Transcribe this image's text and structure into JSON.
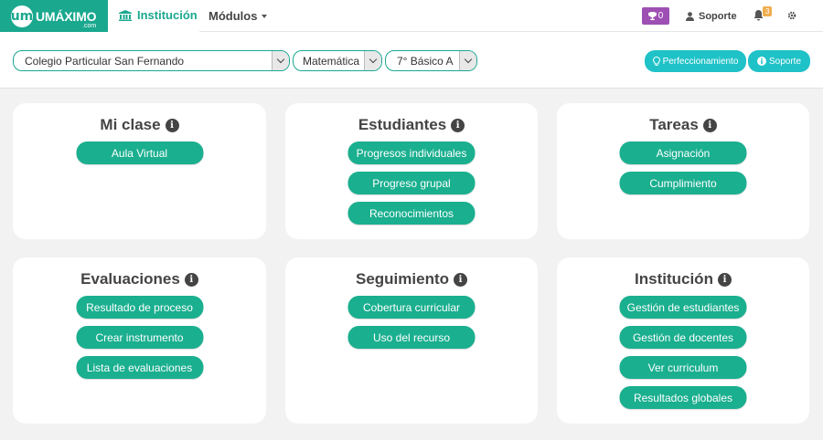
{
  "brand": {
    "name": "UMÁXIMO",
    "sub": ".com",
    "badge": "um",
    "color": "#1aa88f"
  },
  "nav": {
    "institucion": "Institución",
    "modulos": "Módulos",
    "trophy_count": "0",
    "soporte": "Soporte",
    "notifications": "3"
  },
  "filters": {
    "colegio": "Colegio Particular San Fernando",
    "asignatura": "Matemática",
    "curso": "7° Básico A"
  },
  "actions": {
    "perfeccionamiento": "Perfeccionamiento",
    "soporte": "Soporte"
  },
  "cards": [
    {
      "title": "Mi clase",
      "buttons": [
        "Aula Virtual"
      ]
    },
    {
      "title": "Estudiantes",
      "buttons": [
        "Progresos individuales",
        "Progreso grupal",
        "Reconocimientos"
      ]
    },
    {
      "title": "Tareas",
      "buttons": [
        "Asignación",
        "Cumplimiento"
      ]
    },
    {
      "title": "Evaluaciones",
      "buttons": [
        "Resultado de proceso",
        "Crear instrumento",
        "Lista de evaluaciones"
      ]
    },
    {
      "title": "Seguimiento",
      "buttons": [
        "Cobertura curricular",
        "Uso del recurso"
      ]
    },
    {
      "title": "Institución",
      "buttons": [
        "Gestión de estudiantes",
        "Gestión de docentes",
        "Ver curriculum",
        "Resultados globales"
      ]
    }
  ]
}
